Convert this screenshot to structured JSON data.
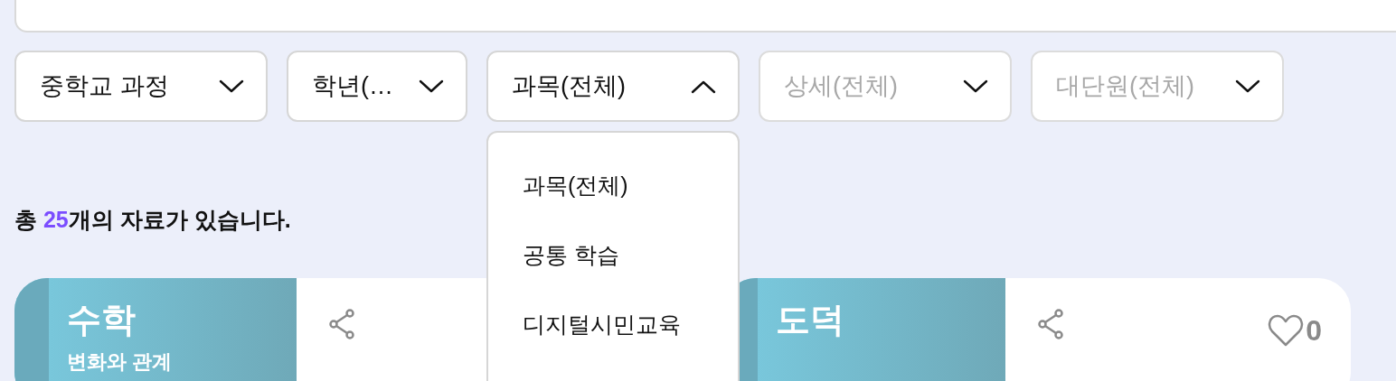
{
  "filters": [
    {
      "label": "중학교 과정",
      "open": false,
      "disabled": false
    },
    {
      "label": "학년(…",
      "open": false,
      "disabled": false
    },
    {
      "label": "과목(전체)",
      "open": true,
      "disabled": false,
      "options": [
        "과목(전체)",
        "공통 학습",
        "디지털시민교육"
      ]
    },
    {
      "label": "상세(전체)",
      "open": false,
      "disabled": true
    },
    {
      "label": "대단원(전체)",
      "open": false,
      "disabled": true
    }
  ],
  "summary": {
    "before": "총 ",
    "count": "25",
    "after": "개의 자료가 있습니다."
  },
  "cards": [
    {
      "subject": "수학",
      "subtitle": "변화와 관계"
    },
    {
      "subject": "도덕",
      "likes": "0"
    }
  ]
}
